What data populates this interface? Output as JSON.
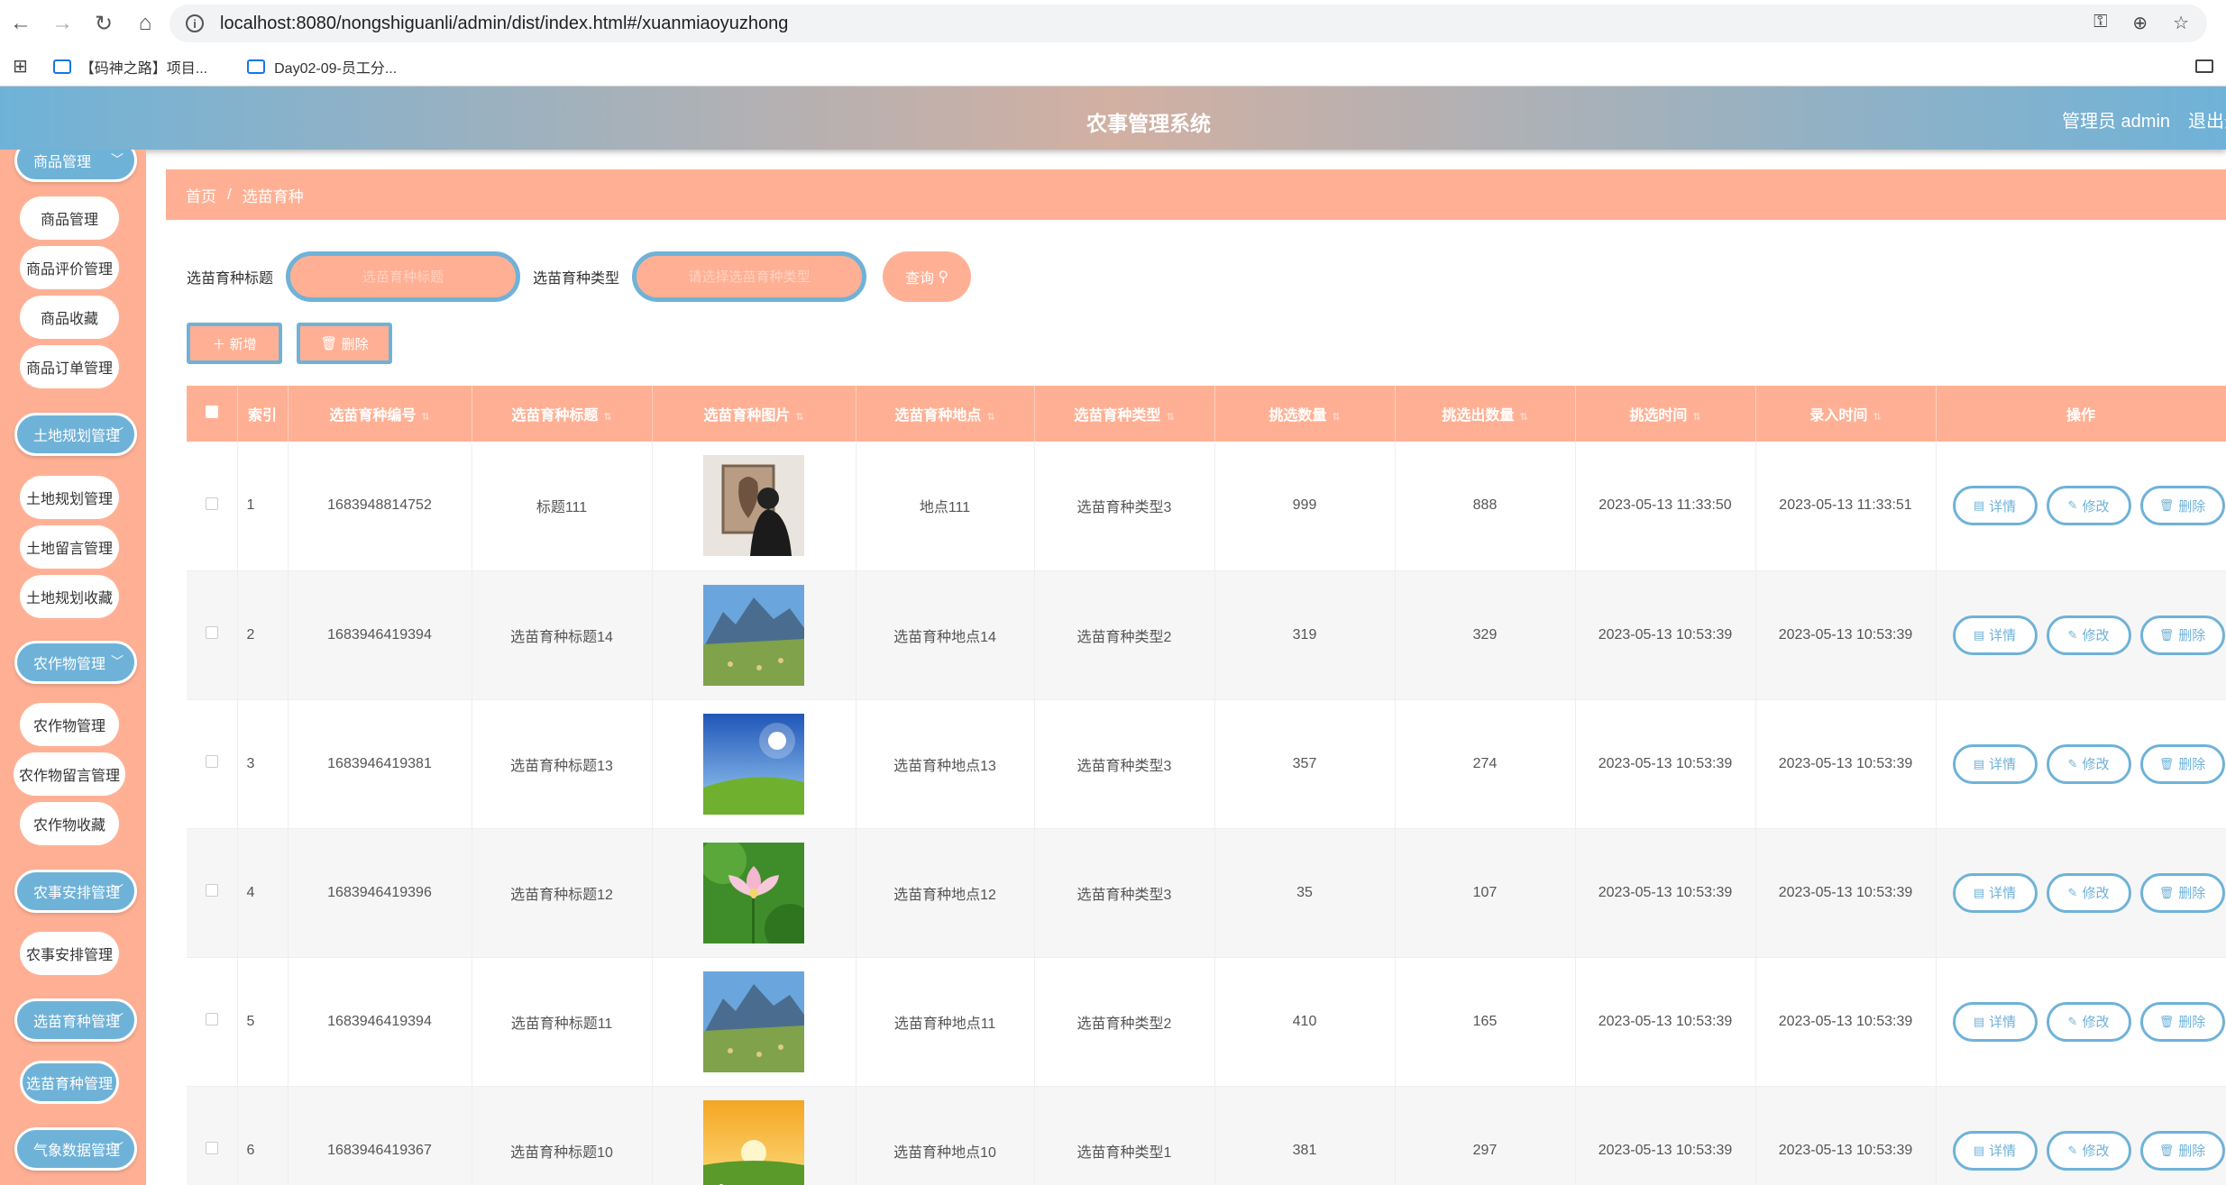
{
  "browser": {
    "url": "localhost:8080/nongshiguanli/admin/dist/index.html#/xuanmiaoyuzhong",
    "bookmarks": [
      "【码神之路】项目...",
      "Day02-09-员工分..."
    ]
  },
  "header": {
    "title": "农事管理系统",
    "admin_label": "管理员 admin",
    "logout_label": "退出登"
  },
  "sidebar": {
    "groups": [
      {
        "label": "商品管理",
        "items": [
          "商品管理",
          "商品评价管理",
          "商品收藏",
          "商品订单管理"
        ]
      },
      {
        "label": "土地规划管理",
        "items": [
          "土地规划管理",
          "土地留言管理",
          "土地规划收藏"
        ]
      },
      {
        "label": "农作物管理",
        "items": [
          "农作物管理",
          "农作物留言管理",
          "农作物收藏"
        ]
      },
      {
        "label": "农事安排管理",
        "items": [
          "农事安排管理"
        ]
      },
      {
        "label": "选苗育种管理",
        "items": [
          "选苗育种管理"
        ]
      },
      {
        "label": "气象数据管理",
        "items": []
      }
    ],
    "active_item": "选苗育种管理"
  },
  "breadcrumb": {
    "home": "首页",
    "current": "选苗育种",
    "separator": "/"
  },
  "search": {
    "title_label": "选苗育种标题",
    "title_placeholder": "选苗育种标题",
    "type_label": "选苗育种类型",
    "type_placeholder": "请选择选苗育种类型",
    "query_label": "查询"
  },
  "actions": {
    "add_label": "新增",
    "delete_label": "删除"
  },
  "table": {
    "columns": [
      "索引",
      "选苗育种编号",
      "选苗育种标题",
      "选苗育种图片",
      "选苗育种地点",
      "选苗育种类型",
      "挑选数量",
      "挑选出数量",
      "挑选时间",
      "录入时间",
      "操作"
    ],
    "rows": [
      {
        "index": "1",
        "code": "1683948814752",
        "title": "标题111",
        "image": "person-photo",
        "place": "地点111",
        "type": "选苗育种类型3",
        "count": "999",
        "picked": "888",
        "pick_time": "2023-05-13 11:33:50",
        "entry_time": "2023-05-13 11:33:51"
      },
      {
        "index": "2",
        "code": "1683946419394",
        "title": "选苗育种标题14",
        "image": "mountain-photo",
        "place": "选苗育种地点14",
        "type": "选苗育种类型2",
        "count": "319",
        "picked": "329",
        "pick_time": "2023-05-13 10:53:39",
        "entry_time": "2023-05-13 10:53:39"
      },
      {
        "index": "3",
        "code": "1683946419381",
        "title": "选苗育种标题13",
        "image": "sky-photo",
        "place": "选苗育种地点13",
        "type": "选苗育种类型3",
        "count": "357",
        "picked": "274",
        "pick_time": "2023-05-13 10:53:39",
        "entry_time": "2023-05-13 10:53:39"
      },
      {
        "index": "4",
        "code": "1683946419396",
        "title": "选苗育种标题12",
        "image": "lotus-photo",
        "place": "选苗育种地点12",
        "type": "选苗育种类型3",
        "count": "35",
        "picked": "107",
        "pick_time": "2023-05-13 10:53:39",
        "entry_time": "2023-05-13 10:53:39"
      },
      {
        "index": "5",
        "code": "1683946419394",
        "title": "选苗育种标题11",
        "image": "mountain-photo",
        "place": "选苗育种地点11",
        "type": "选苗育种类型2",
        "count": "410",
        "picked": "165",
        "pick_time": "2023-05-13 10:53:39",
        "entry_time": "2023-05-13 10:53:39"
      },
      {
        "index": "6",
        "code": "1683946419367",
        "title": "选苗育种标题10",
        "image": "sunset-photo",
        "place": "选苗育种地点10",
        "type": "选苗育种类型1",
        "count": "381",
        "picked": "297",
        "pick_time": "2023-05-13 10:53:39",
        "entry_time": "2023-05-13 10:53:39"
      }
    ],
    "row_actions": {
      "detail": "详情",
      "edit": "修改",
      "delete": "删除"
    }
  },
  "colors": {
    "primary": "#ffb094",
    "accent": "#6fb2d8"
  }
}
